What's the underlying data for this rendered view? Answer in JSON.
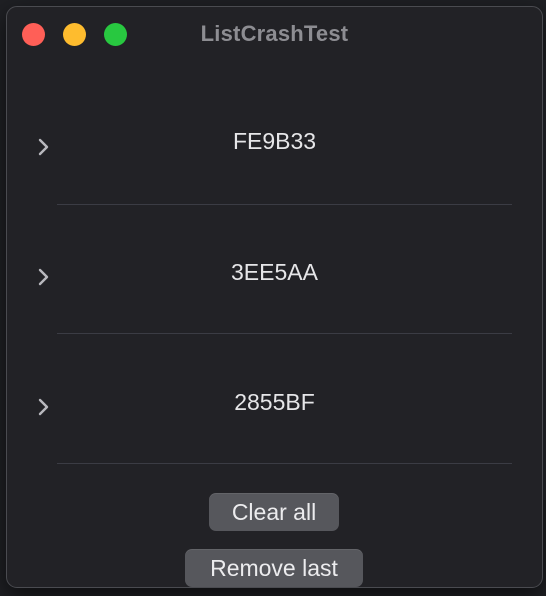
{
  "window": {
    "title": "ListCrashTest"
  },
  "list": {
    "items": [
      {
        "label": "FE9B33"
      },
      {
        "label": "3EE5AA"
      },
      {
        "label": "2855BF"
      }
    ]
  },
  "buttons": {
    "clear_all": "Clear all",
    "remove_last": "Remove last"
  },
  "colors": {
    "close": "#ff5f57",
    "minimize": "#febc2e",
    "zoom": "#28c840",
    "window_bg": "#222226",
    "button_bg": "#56575c"
  },
  "icons": {
    "row_disclosure": "chevron-right-icon"
  }
}
